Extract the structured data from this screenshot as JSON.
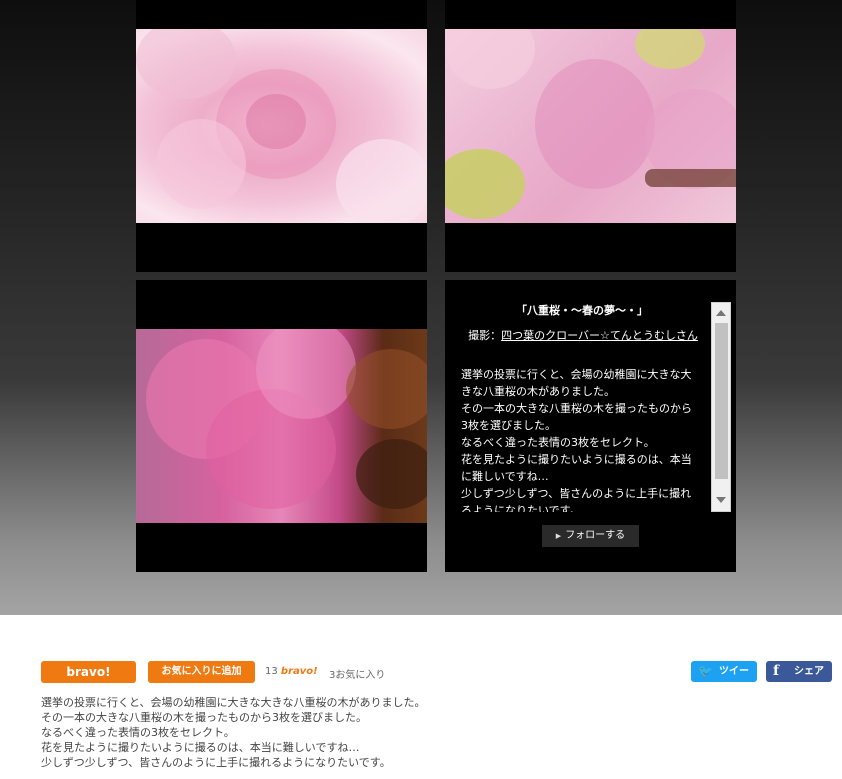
{
  "work": {
    "title": "「八重桜・～春の夢～・」",
    "photographer_label": "撮影：",
    "photographer_name": "四つ葉のクローバー☆てんとうむしさん",
    "caption": "選挙の投票に行くと、会場の幼稚園に大きな大きな八重桜の木がありました。\nその一本の大きな八重桜の木を撮ったものから3枚を選びました。\nなるべく違った表情の3枚をセレクト。\n花を見たように撮りたいように撮るのは、本当に難しいですね…\n少しずつ少しずつ、皆さんのように上手に撮れるようになりたいです。",
    "follow_label": "フォローする"
  },
  "actions": {
    "bravo_label": "bravo!",
    "favorite_label": "お気に入りに追加",
    "bravo_count": "13",
    "bravo_word": "bravo!",
    "favorite_count": "3お気に入り"
  },
  "share": {
    "tweet_label": "ツイート",
    "facebook_label": "シェア"
  },
  "colors": {
    "accent_orange": "#f07a12",
    "twitter_blue": "#1da1f2",
    "facebook_blue": "#3b5998"
  }
}
